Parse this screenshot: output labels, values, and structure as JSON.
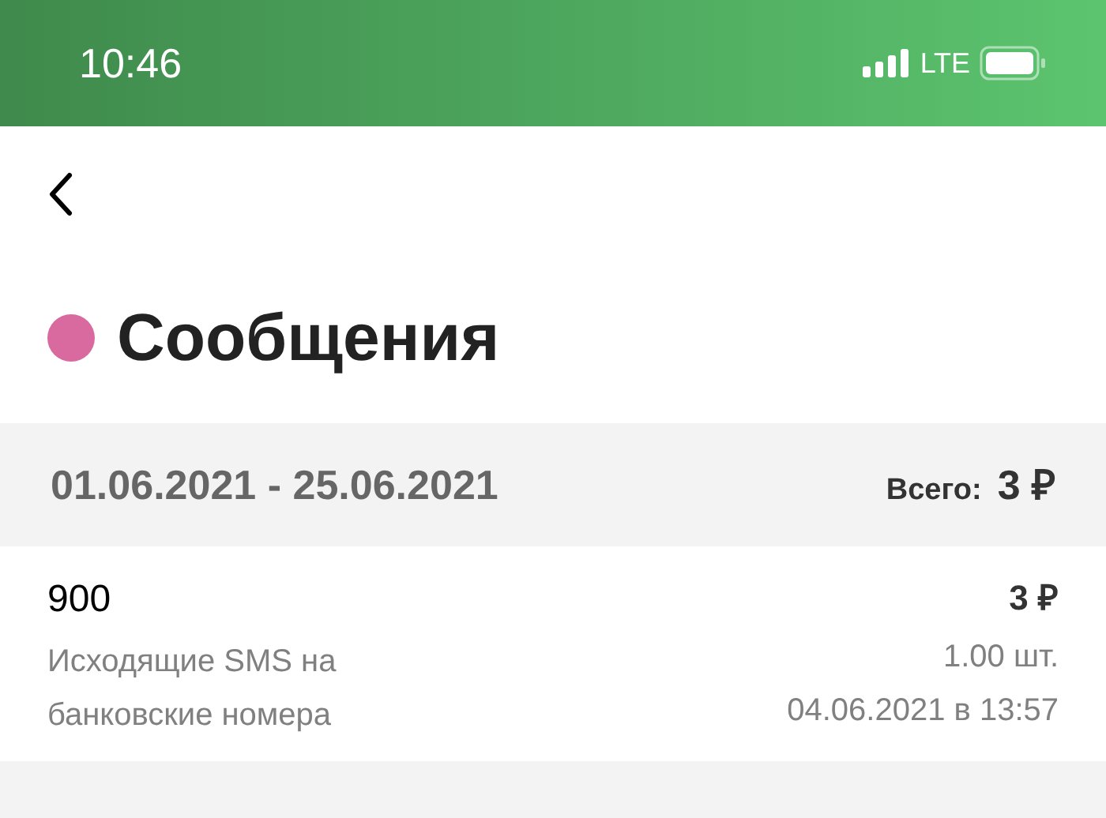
{
  "status_bar": {
    "time": "10:46",
    "network": "LTE"
  },
  "header": {
    "title": "Сообщения",
    "color": "#d96a9f"
  },
  "period": {
    "range": "01.06.2021 - 25.06.2021",
    "total_label": "Всего:",
    "total": "3 ₽"
  },
  "items": [
    {
      "number": "900",
      "description": "Исходящие SMS на банковские номера",
      "amount": "3 ₽",
      "quantity": "1.00 шт.",
      "datetime": "04.06.2021 в 13:57"
    }
  ]
}
